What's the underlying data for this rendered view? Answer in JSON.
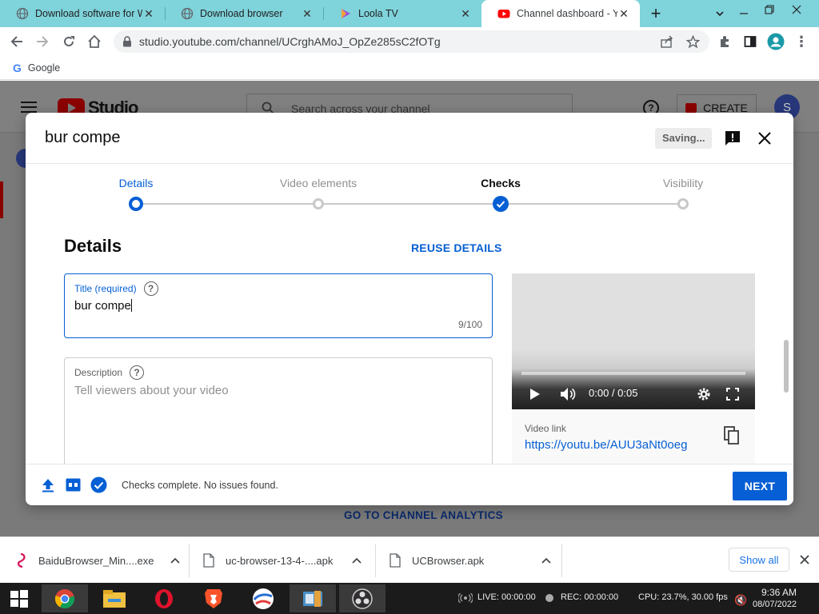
{
  "browser": {
    "tabs": [
      {
        "title": "Download software for W",
        "active": false
      },
      {
        "title": "Download browser",
        "active": false
      },
      {
        "title": "Loola TV",
        "active": false
      },
      {
        "title": "Channel dashboard - You",
        "active": true
      }
    ],
    "new_tab": "+",
    "url": "studio.youtube.com/channel/UCrghAMoJ_OpZe285sC2fOTg",
    "bookmark": "Google",
    "profile_initial": "S"
  },
  "studio_bg": {
    "logo": "Studio",
    "search_placeholder": "Search across your channel",
    "create": "CREATE",
    "avatar": "S",
    "analytics": "GO TO CHANNEL ANALYTICS"
  },
  "dialog": {
    "title": "bur compe",
    "saving": "Saving...",
    "steps": [
      {
        "label": "Details",
        "state": "current"
      },
      {
        "label": "Video elements",
        "state": "pending"
      },
      {
        "label": "Checks",
        "state": "done"
      },
      {
        "label": "Visibility",
        "state": "pending"
      }
    ],
    "section_title": "Details",
    "reuse_label": "REUSE DETAILS",
    "title_field": {
      "label": "Title (required)",
      "value": "bur compe",
      "count": "9/100"
    },
    "description_field": {
      "label": "Description",
      "placeholder": "Tell viewers about your video"
    },
    "video": {
      "time": "0:00 / 0:05",
      "link_label": "Video link",
      "link": "https://youtu.be/AUU3aNt0oeg"
    },
    "footer": {
      "status": "Checks complete. No issues found.",
      "next_label": "NEXT"
    }
  },
  "downloads": {
    "items": [
      {
        "name": "BaiduBrowser_Min....exe"
      },
      {
        "name": "uc-browser-13-4-....apk"
      },
      {
        "name": "UCBrowser.apk"
      }
    ],
    "show_all": "Show all"
  },
  "taskbar": {
    "live": "LIVE: 00:00:00",
    "rec": "REC: 00:00:00",
    "cpu": "CPU: 23.7%, 30.00 fps",
    "time": "9:36 AM",
    "date": "08/07/2022"
  },
  "colors": {
    "accent": "#065fd4",
    "tabstrip": "#7fd3da"
  }
}
